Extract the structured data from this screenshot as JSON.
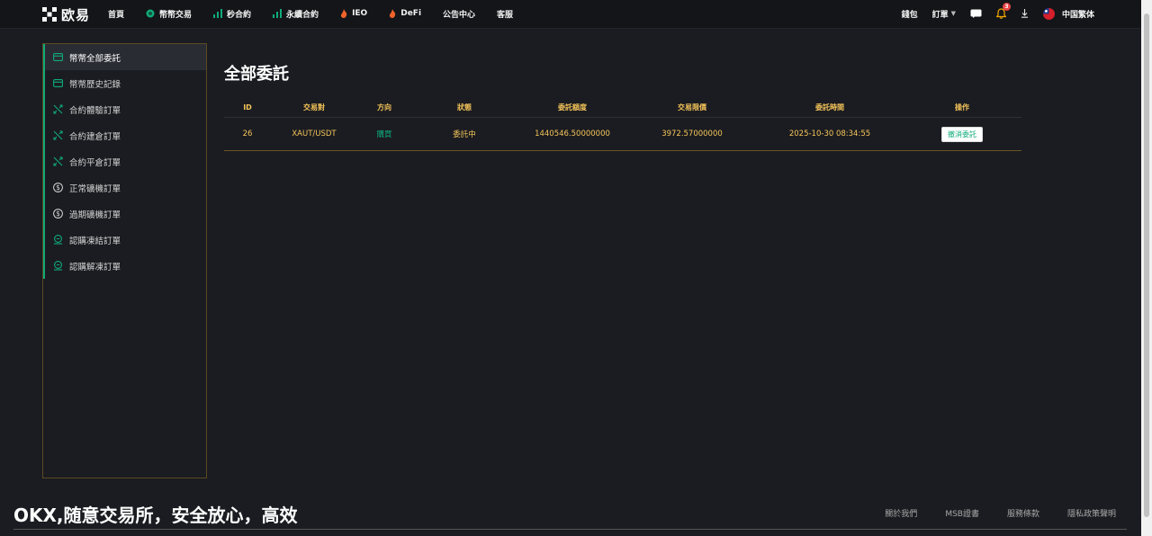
{
  "brand": {
    "name": "欧易",
    "logo_icon": "okx-logo-icon"
  },
  "nav": {
    "items": [
      {
        "label": "首頁",
        "icon": ""
      },
      {
        "label": "幣幣交易",
        "icon": "coin-icon"
      },
      {
        "label": "秒合約",
        "icon": "bar-chart-icon"
      },
      {
        "label": "永續合約",
        "icon": "bar-chart-icon"
      },
      {
        "label": "IEO",
        "icon": "flame-icon"
      },
      {
        "label": "DeFi",
        "icon": "flame-icon"
      },
      {
        "label": "公告中心",
        "icon": ""
      },
      {
        "label": "客服",
        "icon": ""
      }
    ]
  },
  "topright": {
    "wallet": "錢包",
    "orders": "訂單",
    "notification_count": "3",
    "language": "中国繁体",
    "icons": [
      "chat-icon",
      "bell-icon",
      "download-icon",
      "taiwan-flag-icon"
    ]
  },
  "sidebar": {
    "items": [
      {
        "label": "幣幣全部委託",
        "icon": "card-icon",
        "active": true
      },
      {
        "label": "幣幣歷史記錄",
        "icon": "card-icon"
      },
      {
        "label": "合約體驗訂單",
        "icon": "swap-arrows-icon"
      },
      {
        "label": "合約建倉訂單",
        "icon": "swap-arrows-icon"
      },
      {
        "label": "合約平倉訂單",
        "icon": "swap-arrows-icon"
      },
      {
        "label": "正常礦機訂單",
        "icon": "dollar-circle-icon"
      },
      {
        "label": "過期礦機訂單",
        "icon": "dollar-circle-icon"
      },
      {
        "label": "認購凍結訂單",
        "icon": "lock-coin-icon"
      },
      {
        "label": "認購解凍訂單",
        "icon": "lock-coin-icon"
      }
    ]
  },
  "main": {
    "title": "全部委託",
    "table": {
      "headers": [
        "ID",
        "交易對",
        "方向",
        "狀態",
        "委託額度",
        "交易限價",
        "委託時間",
        "操作"
      ],
      "rows": [
        {
          "id": "26",
          "pair": "XAUT/USDT",
          "direction": "購買",
          "status": "委託中",
          "amount": "1440546.50000000",
          "limit_price": "3972.57000000",
          "time": "2025-10-30 08:34:55",
          "action": "撤消委託"
        }
      ]
    }
  },
  "footer": {
    "slogan": "OKX,随意交易所，安全放心，高效",
    "links": [
      "關於我們",
      "MSB證書",
      "服務條款",
      "隱私政策聲明"
    ]
  },
  "colors": {
    "accent_green": "#0fab79",
    "table_text": "#f6c65a",
    "background": "#1b1c21",
    "sidebar_border": "#5c4a22"
  }
}
